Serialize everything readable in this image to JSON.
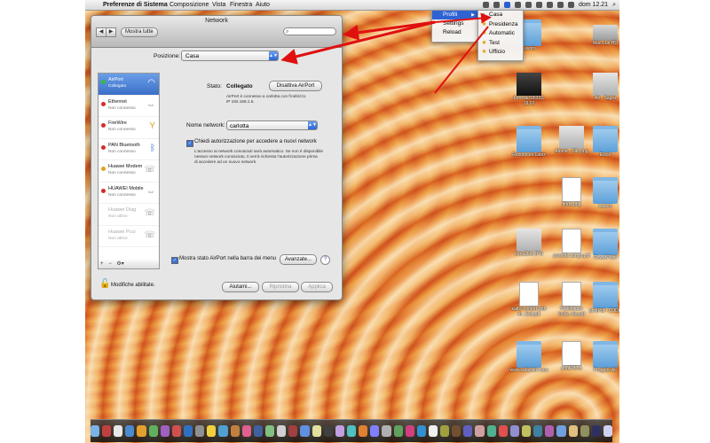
{
  "menubar": {
    "app": "Preferenze di Sistema",
    "items": [
      "Composizione",
      "Vista",
      "Finestra",
      "Aiuto"
    ],
    "clock": "dom 12.21"
  },
  "window": {
    "title": "Network",
    "back": "◀",
    "forward": "▶",
    "show_all": "Mostra tutte",
    "search_placeholder": "",
    "position_label": "Posizione:",
    "position_value": "Casa"
  },
  "interfaces": [
    {
      "name": "AirPort",
      "status": "Collegato",
      "dot": "#38b83a",
      "icon": "wifi-icon",
      "selected": true,
      "dim": false
    },
    {
      "name": "Ethernet",
      "status": "Non connesso",
      "dot": "#d62b2b",
      "icon": "ethernet-icon",
      "selected": false,
      "dim": false
    },
    {
      "name": "FireWire",
      "status": "Non connesso",
      "dot": "#d62b2b",
      "icon": "firewire-icon",
      "selected": false,
      "dim": false
    },
    {
      "name": "PAN Bluetooth",
      "status": "Non connesso",
      "dot": "#d62b2b",
      "icon": "bluetooth-icon",
      "selected": false,
      "dim": false
    },
    {
      "name": "Huawei Modem",
      "status": "Non connesso",
      "dot": "#e3a21a",
      "icon": "phone-icon",
      "selected": false,
      "dim": false
    },
    {
      "name": "HUAWEI Mobile",
      "status": "Non connesso",
      "dot": "#d62b2b",
      "icon": "ethernet-icon",
      "selected": false,
      "dim": false
    },
    {
      "name": "Huawei Diag",
      "status": "Non attivo",
      "dot": "",
      "icon": "phone-icon",
      "selected": false,
      "dim": true
    },
    {
      "name": "Huawei Pcui",
      "status": "Non attivo",
      "dot": "",
      "icon": "phone-icon",
      "selected": false,
      "dim": true
    }
  ],
  "list_bar": {
    "add": "+",
    "remove": "−",
    "gear": "⚙▾"
  },
  "detail": {
    "status_label": "Stato:",
    "status_value": "Collegato",
    "disable_button": "Disattiva AirPort",
    "status_desc_1": "AirPort è connesso a carlotta con l'indirizzo",
    "status_desc_2": "IP 192.168.1.5.",
    "network_label": "Nome network:",
    "network_value": "carlotta",
    "ask_label": "Chiedi autorizzazione per accedere a nuovi network",
    "ask_desc_1": "L'accesso ai network conosciuti sarà automatico. Se non è disponibile",
    "ask_desc_2": "nessun network conosciuto, ti verrà richiesta l'autorizzazione prima",
    "ask_desc_3": "di accedere ad un nuovo network.",
    "show_status": "Mostra stato AirPort nella barra dei menu",
    "advanced": "Avanzate...",
    "help": "?"
  },
  "footer": {
    "lock_label": "Modifiche abilitate.",
    "help_btn": "Aiutami...",
    "revert": "Ripristina",
    "apply": "Applica"
  },
  "profili_menu": {
    "items": [
      "Profili",
      "Settings",
      "Reload"
    ]
  },
  "sub_menu": {
    "items": [
      "Casa",
      "Presidenza",
      "Automatic",
      "Test",
      "Ufficio"
    ]
  },
  "desktop_icons": [
    {
      "label": "Lavoro",
      "kind": "folder"
    },
    {
      "label": "Mac-Lun HD",
      "kind": "hd"
    },
    {
      "label": "Foto del 05332, 19.02",
      "kind": "img"
    },
    {
      "label": "Air - Sagra",
      "kind": "img2"
    },
    {
      "label": "Resources Latex",
      "kind": "folder"
    },
    {
      "label": "Airone - Sito.png",
      "kind": "img2"
    },
    {
      "label": "Excel",
      "kind": "folder"
    },
    {
      "label": "firma.png",
      "kind": "doc"
    },
    {
      "label": "Lavoro",
      "kind": "folder"
    },
    {
      "label": "firma2lab.JPG",
      "kind": "img2"
    },
    {
      "label": "pesente sango.pdf",
      "kind": "doc"
    },
    {
      "label": "PowerPoint",
      "kind": "folder"
    },
    {
      "label": "kathy confort with m...text.pdf",
      "kind": "doc"
    },
    {
      "label": "Preliminare locbz..nta.pdf",
      "kind": "doc"
    },
    {
      "label": "printPdf - CODE",
      "kind": "folder"
    },
    {
      "label": "www.safarisite mou",
      "kind": "folder"
    },
    {
      "label": "printPdf.rb",
      "kind": "doc"
    },
    {
      "label": "Progetto Air",
      "kind": "folder"
    }
  ],
  "colors": {
    "selection": "#3a6fc8",
    "arrow": "#e01010"
  }
}
